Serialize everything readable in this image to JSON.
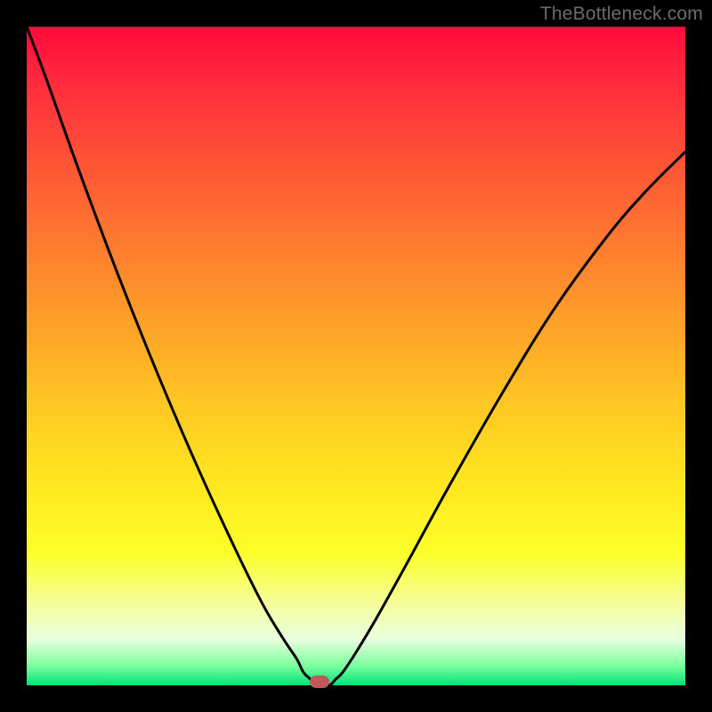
{
  "watermark": "TheBottleneck.com",
  "colors": {
    "frame": "#000000",
    "curve": "#000000",
    "marker": "#c05a5a",
    "watermark_text": "#6b6b6b"
  },
  "chart_data": {
    "type": "line",
    "title": "",
    "xlabel": "",
    "ylabel": "",
    "xlim": [
      0,
      100
    ],
    "ylim": [
      0,
      100
    ],
    "grid": false,
    "legend": false,
    "curve_x": [
      0,
      3,
      8,
      14,
      20,
      26,
      32,
      36,
      39,
      41,
      42,
      43,
      44,
      45,
      46,
      47,
      48,
      50,
      53,
      58,
      64,
      72,
      80,
      88,
      94,
      100
    ],
    "curve_y": [
      100,
      92,
      78,
      62,
      47,
      33,
      20,
      12,
      7,
      4,
      2,
      1,
      0,
      0,
      0,
      1,
      2,
      5,
      10,
      19,
      30,
      44,
      57,
      68,
      75,
      81
    ],
    "minimum": {
      "x": 44.5,
      "y": 0
    },
    "note": "Axes have no tick labels or numeric scale in the source image; values are normalized 0-100 estimates read from the plot geometry."
  }
}
